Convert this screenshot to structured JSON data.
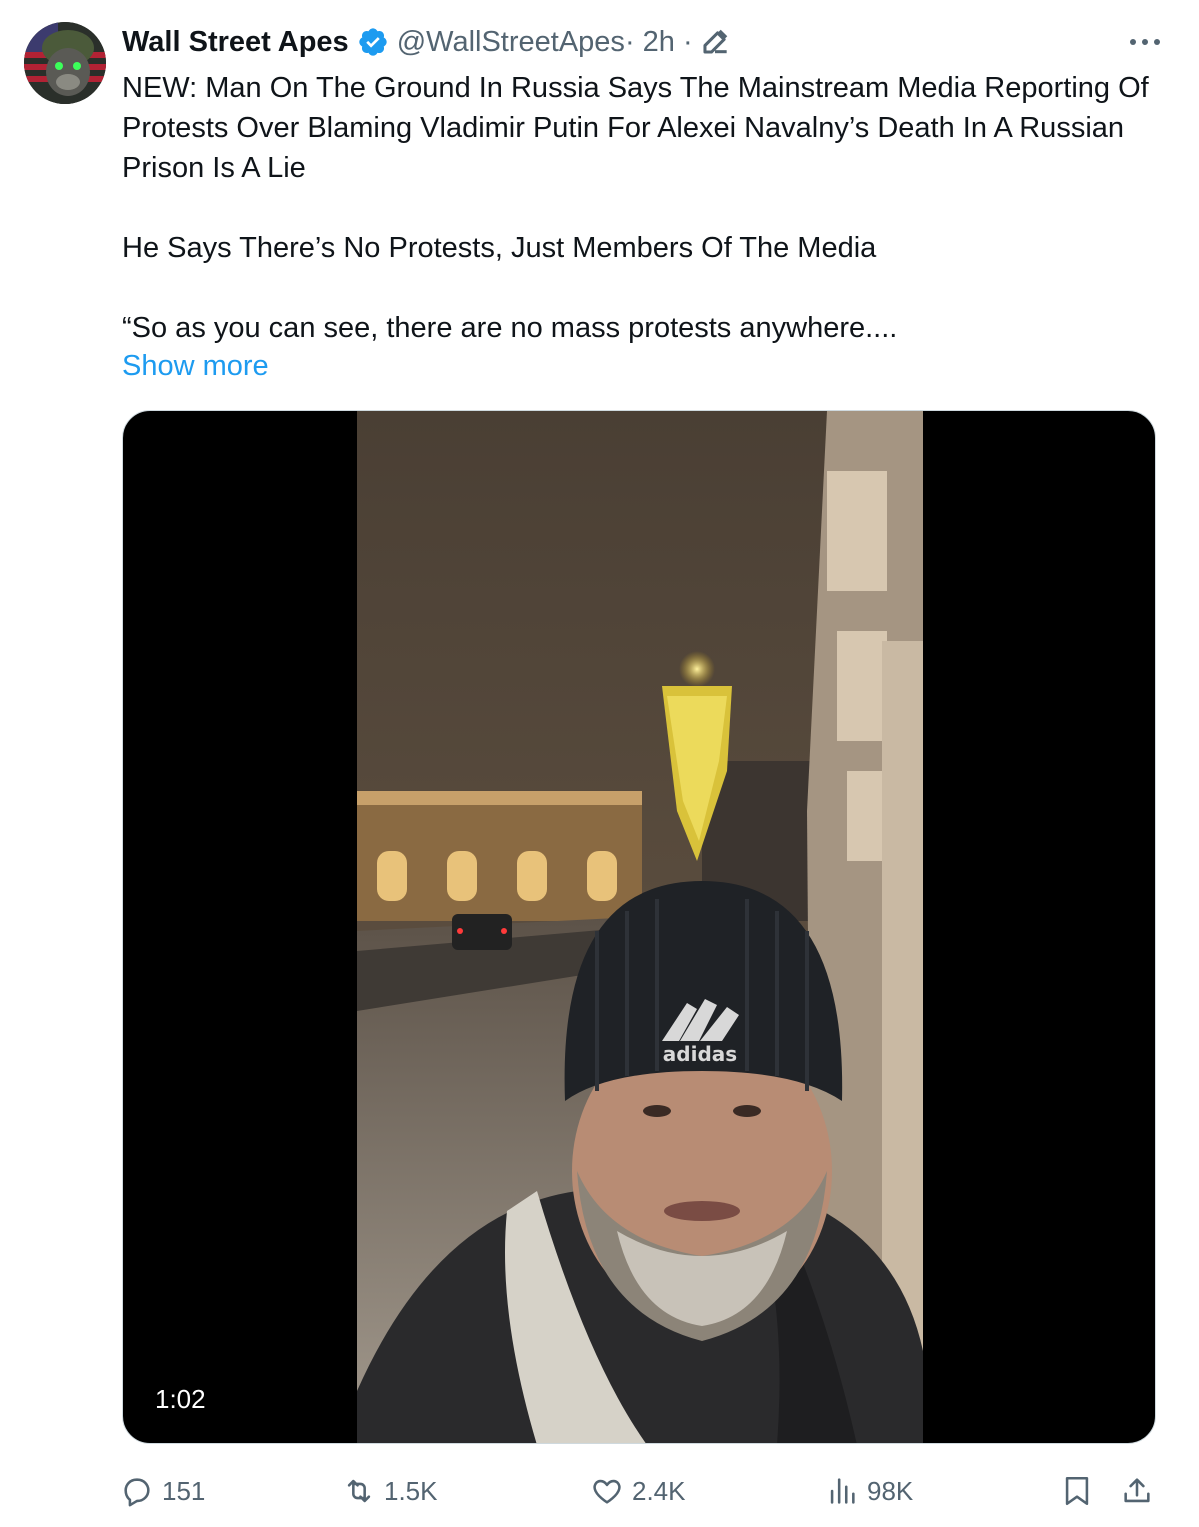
{
  "tweet": {
    "author_name": "Wall Street Apes",
    "handle": "@WallStreetApes",
    "time": " · 2h · ",
    "paragraphs": [
      "NEW: Man On The Ground In Russia Says The Mainstream Media Reporting Of Protests Over Blaming Vladimir Putin For Alexei Navalny’s Death In A Russian Prison Is A Lie",
      "He Says There’s No Protests, Just Members Of The Media",
      "“So as you can see, there are no mass protests anywhere...."
    ],
    "show_more": "Show more"
  },
  "video": {
    "duration": "1:02",
    "hat_text": "adidas"
  },
  "actions": {
    "replies": "151",
    "reposts": "1.5K",
    "likes": "2.4K",
    "views": "98K"
  },
  "colors": {
    "accent": "#1d9bf0",
    "secondary_text": "#536471"
  },
  "icons": [
    "verified-badge-icon",
    "edit-icon",
    "more-icon",
    "reply-icon",
    "repost-icon",
    "like-icon",
    "views-icon",
    "bookmark-icon",
    "share-icon"
  ]
}
